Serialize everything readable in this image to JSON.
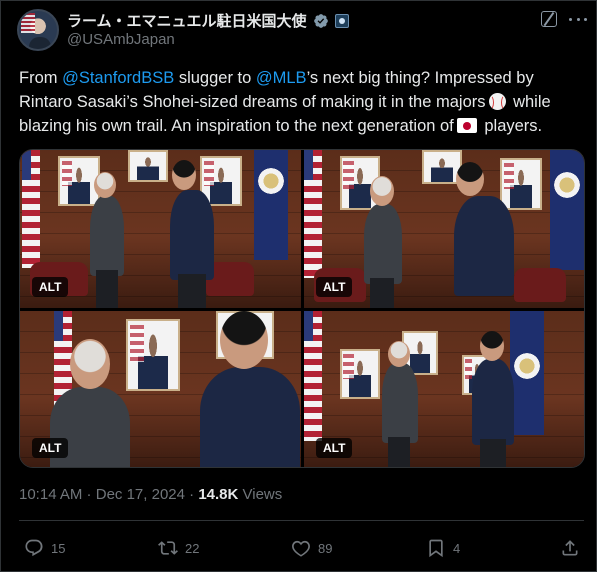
{
  "header": {
    "display_name": "ラーム・エマニュエル駐日米国大使",
    "handle": "@USAmbJapan",
    "verified_icon": "verified-badge-icon",
    "affiliation_icon": "affiliate-badge-icon"
  },
  "tweet": {
    "text": {
      "t1": "From ",
      "m1": "@StanfordBSB",
      "t2": " slugger to ",
      "m2": "@MLB",
      "t3": "’s next big thing? Impressed by Rintaro Sasaki’s Shohei-sized dreams of making it in the majors",
      "t4": " while blazing his own trail. An inspiration to the next generation of",
      "t5": " players."
    },
    "emoji": [
      "baseball-icon",
      "japan-flag-icon"
    ]
  },
  "media": {
    "alt_labels": [
      "ALT",
      "ALT",
      "ALT",
      "ALT"
    ]
  },
  "meta": {
    "time": "10:14 AM",
    "sep": " · ",
    "date": "Dec 17, 2024",
    "dot": " · ",
    "views_count": "14.8K",
    "views_label": " Views"
  },
  "actions": {
    "replies": "15",
    "reposts": "22",
    "likes": "89",
    "bookmarks": "4"
  },
  "colors": {
    "background": "#000000",
    "text": "#e7e9ea",
    "muted": "#71767b",
    "link": "#1d9bf0",
    "border": "#2f3336"
  }
}
